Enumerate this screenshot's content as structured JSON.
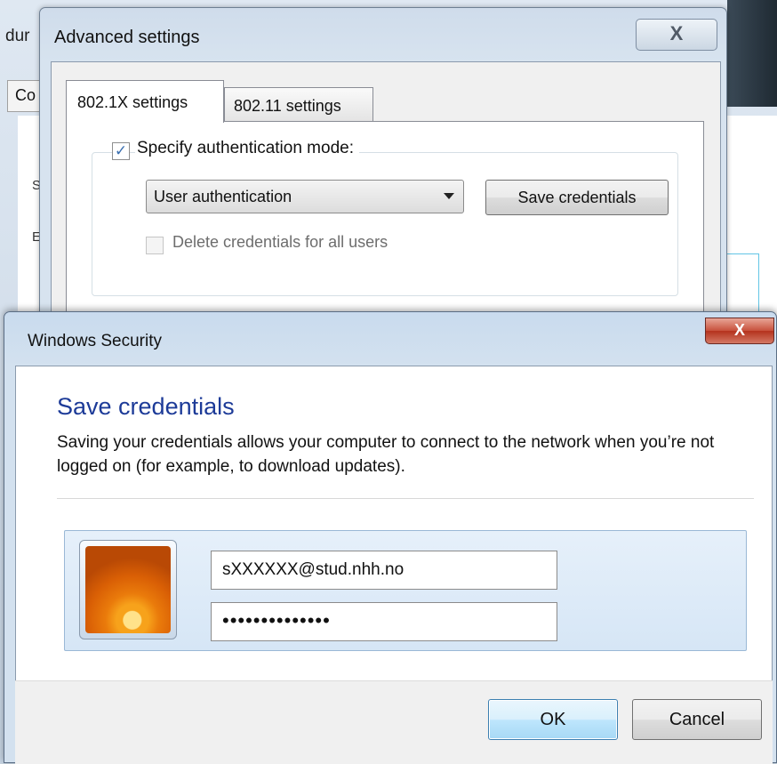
{
  "background_window": {
    "title_fragment": "dur",
    "tab_fragment": "Co",
    "fragment_s": "S",
    "fragment_e": "E"
  },
  "advanced_settings": {
    "title": "Advanced settings",
    "close_glyph": "X",
    "tabs": [
      {
        "label": "802.1X settings",
        "active": true
      },
      {
        "label": "802.11 settings",
        "active": false
      }
    ],
    "specify_auth_mode": {
      "label": "Specify authentication mode:",
      "checked": true
    },
    "auth_mode_select": {
      "value": "User authentication"
    },
    "save_credentials_button": "Save credentials",
    "delete_credentials": {
      "label": "Delete credentials for all users",
      "checked": false,
      "enabled": false
    }
  },
  "windows_security": {
    "title": "Windows Security",
    "close_glyph": "X",
    "heading": "Save credentials",
    "description": "Saving your credentials allows your computer to connect to the network when you’re not logged on (for example, to download updates).",
    "username_value": "sXXXXXX@stud.nhh.no",
    "password_masked": "••••••••••••••",
    "ok_label": "OK",
    "cancel_label": "Cancel"
  },
  "colors": {
    "heading_blue": "#1d3b98",
    "close_red": "#c7503b",
    "default_button_border": "#3c7fb1"
  },
  "icons": {
    "checkbox_checked": "✓",
    "dropdown": "chevron-down-icon",
    "avatar": "user-avatar-flower"
  }
}
